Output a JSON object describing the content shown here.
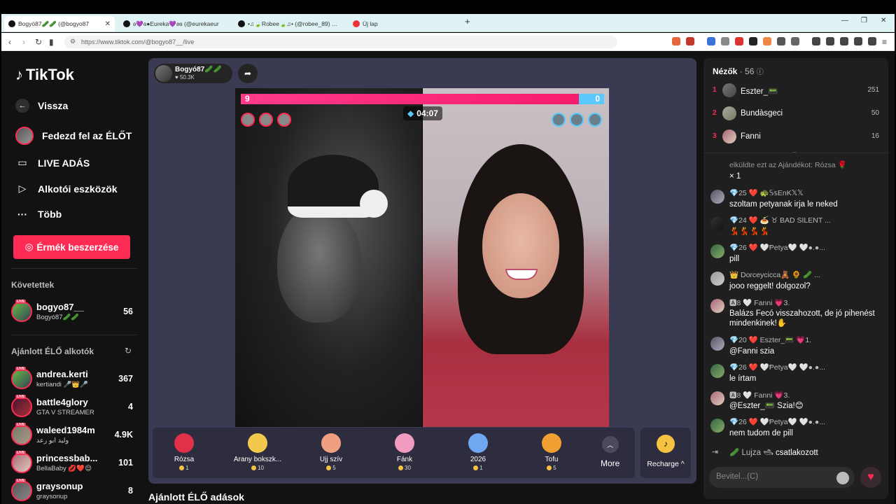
{
  "browser": {
    "tabs": [
      {
        "title": "Bogyó87🥒🥒 (@bogyo87",
        "active": true
      },
      {
        "title": "ʚ💜ɞ●Eʊreka💜ʚɞ (@eurekaeur",
        "active": false
      },
      {
        "title": "•♫🍃Robee🍃♫• (@robee_89) ÉLŐ a",
        "active": false
      },
      {
        "title": "Új lap",
        "active": false
      }
    ],
    "new_tab": "+",
    "url": "https://www.tiktok.com/@bogyo87__/live"
  },
  "sidebar": {
    "logo": "TikTok",
    "back": "Vissza",
    "nav": [
      "Fedezd fel az ÉLŐT",
      "LIVE ADÁS",
      "Alkotói eszközök",
      "Több"
    ],
    "coins_button": "Érmék beszerzése",
    "following_title": "Követettek",
    "following": [
      {
        "name": "bogyo87__",
        "sub": "Bogyó87🥒🥒",
        "count": "56"
      }
    ],
    "recommended_title": "Ajánlott ÉLŐ alkotók",
    "recommended": [
      {
        "name": "andrea.kerti",
        "sub": "kertiandi 🎤👑🎤",
        "count": "367"
      },
      {
        "name": "battle4glory",
        "sub": "GTA V STREAMER",
        "count": "4"
      },
      {
        "name": "waleed1984m",
        "sub": "وليد ابو رعد",
        "count": "4.9K"
      },
      {
        "name": "princessbab...",
        "sub": "BellaBaby 💋❤️😌",
        "count": "101"
      },
      {
        "name": "graysonup",
        "sub": "graysonup",
        "count": "8"
      }
    ]
  },
  "stage": {
    "host_name": "Bogyó87🥒🥒",
    "host_likes": "50.3K",
    "score_left": "9",
    "score_right": "0",
    "score_fraction_left": 0.93,
    "timer": "04:07",
    "gifts": [
      {
        "name": "Rózsa",
        "price": "1",
        "color": "#e0304a"
      },
      {
        "name": "Arany bokszk...",
        "price": "10",
        "color": "#f2c94c"
      },
      {
        "name": "Ujj szív",
        "price": "5",
        "color": "#f0a080"
      },
      {
        "name": "Fánk",
        "price": "30",
        "color": "#f29bc0"
      },
      {
        "name": "2026",
        "price": "1",
        "color": "#6fa8f0"
      },
      {
        "name": "Tofu",
        "price": "5",
        "color": "#f0a030"
      }
    ],
    "more_label": "More",
    "recharge_label": "Recharge ^",
    "recommended_live_title": "Ajánlott ÉLŐ adások"
  },
  "chat": {
    "viewers_label": "Nézők",
    "viewers_count": "56",
    "viewers": [
      {
        "rank": "1",
        "name": "Eszter_📟",
        "score": "251"
      },
      {
        "rank": "2",
        "name": "Bundàsgeci",
        "score": "50"
      },
      {
        "rank": "3",
        "name": "Fanni",
        "score": "16"
      }
    ],
    "messages": [
      {
        "header": "elküldte ezt az Ajándékot: Rózsa 🌹",
        "text": "× 1"
      },
      {
        "header": "💎25 ❤️ 🐢𝕊𝕤EnK𝕏𝕏",
        "text": "szoltam petyanak irja le neked"
      },
      {
        "header": "💎24 ❤️ 🍝 ♉ BAD SILENT ...",
        "text": "💃💃💃💃"
      },
      {
        "header": "💎26 ❤️ 🤍Ᵽetya🤍 🤍●.●...",
        "text": "pill"
      },
      {
        "header": "👑 Dorceycicca🧸 🌻 🥒 ...",
        "text": "jooo reggelt! dolgozol?"
      },
      {
        "header": "🅰8 🤍 Fanni 💗3.",
        "text": "Balázs Fecó visszahozott, de jó pihenést mindenkinek!✋"
      },
      {
        "header": "💎20 ❤️ Eszter_📟 💗1.",
        "text": "@Fanni szia"
      },
      {
        "header": "💎26 ❤️ 🤍Ᵽetya🤍 🤍●.●...",
        "text": "le írtam"
      },
      {
        "header": "🅰8 🤍 Fanni 💗3.",
        "text": "@Eszter_📟  Szia!😊"
      },
      {
        "header": "💎26 ❤️ 🤍Ᵽetya🤍 🤍●.●...",
        "text": "nem tudom de pill"
      },
      {
        "header": "🥒 Lujza 🛥",
        "text": "csatlakozott"
      }
    ],
    "input_placeholder": "Bevitel...(C)"
  },
  "colors": {
    "accent": "#fe2c55",
    "battle_red": "#f81b6c",
    "battle_blue": "#5ac8fa"
  }
}
